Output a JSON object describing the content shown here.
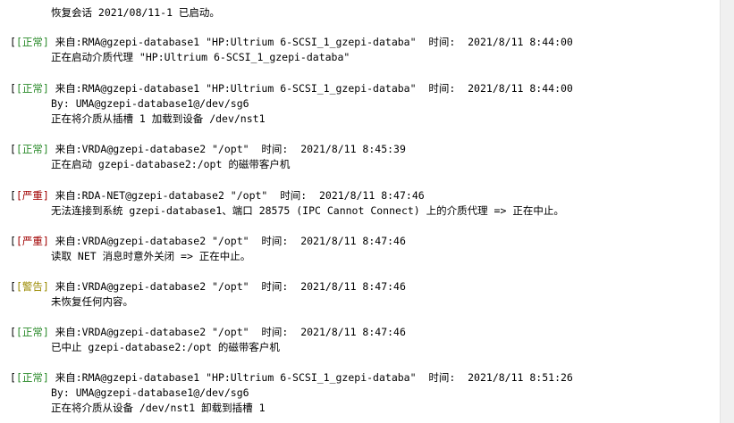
{
  "session_restore": "恢复会话 2021/08/11-1 已启动。",
  "entries": [
    {
      "level": "正常",
      "level_class": "lvl-normal",
      "header": "来自:RMA@gzepi-database1 \"HP:Ultrium 6-SCSI_1_gzepi-databa\"  时间:  2021/8/11 8:44:00",
      "lines": [
        "正在启动介质代理 \"HP:Ultrium 6-SCSI_1_gzepi-databa\""
      ]
    },
    {
      "level": "正常",
      "level_class": "lvl-normal",
      "header": "来自:RMA@gzepi-database1 \"HP:Ultrium 6-SCSI_1_gzepi-databa\"  时间:  2021/8/11 8:44:00",
      "lines": [
        "By: UMA@gzepi-database1@/dev/sg6",
        "正在将介质从插槽 1 加载到设备 /dev/nst1"
      ]
    },
    {
      "level": "正常",
      "level_class": "lvl-normal",
      "header": "来自:VRDA@gzepi-database2 \"/opt\"  时间:  2021/8/11 8:45:39",
      "lines": [
        "正在启动 gzepi-database2:/opt 的磁带客户机"
      ]
    },
    {
      "level": "严重",
      "level_class": "lvl-severe",
      "header": "来自:RDA-NET@gzepi-database2 \"/opt\"  时间:  2021/8/11 8:47:46",
      "lines": [
        "无法连接到系统 gzepi-database1、端口 28575 (IPC Cannot Connect) 上的介质代理 => 正在中止。"
      ]
    },
    {
      "level": "严重",
      "level_class": "lvl-severe",
      "header": "来自:VRDA@gzepi-database2 \"/opt\"  时间:  2021/8/11 8:47:46",
      "lines": [
        "读取 NET 消息时意外关闭 => 正在中止。"
      ]
    },
    {
      "level": "警告",
      "level_class": "lvl-warning",
      "header": "来自:VRDA@gzepi-database2 \"/opt\"  时间:  2021/8/11 8:47:46",
      "lines": [
        "未恢复任何内容。"
      ]
    },
    {
      "level": "正常",
      "level_class": "lvl-normal",
      "header": "来自:VRDA@gzepi-database2 \"/opt\"  时间:  2021/8/11 8:47:46",
      "lines": [
        "已中止 gzepi-database2:/opt 的磁带客户机"
      ]
    },
    {
      "level": "正常",
      "level_class": "lvl-normal",
      "header": "来自:RMA@gzepi-database1 \"HP:Ultrium 6-SCSI_1_gzepi-databa\"  时间:  2021/8/11 8:51:26",
      "lines": [
        "By: UMA@gzepi-database1@/dev/sg6",
        "正在将介质从设备 /dev/nst1 卸载到插槽 1"
      ]
    }
  ]
}
